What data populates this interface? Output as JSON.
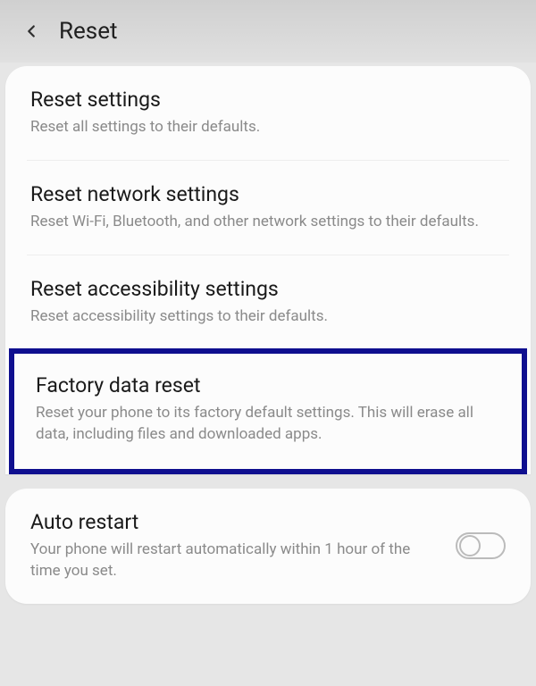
{
  "header": {
    "title": "Reset"
  },
  "items": [
    {
      "title": "Reset settings",
      "desc": "Reset all settings to their defaults."
    },
    {
      "title": "Reset network settings",
      "desc": "Reset Wi-Fi, Bluetooth, and other network settings to their defaults."
    },
    {
      "title": "Reset accessibility settings",
      "desc": "Reset accessibility settings to their defaults."
    },
    {
      "title": "Factory data reset",
      "desc": "Reset your phone to its factory default settings. This will erase all data, including files and downloaded apps."
    }
  ],
  "autoRestart": {
    "title": "Auto restart",
    "desc": "Your phone will restart automatically within 1 hour of the time you set."
  }
}
